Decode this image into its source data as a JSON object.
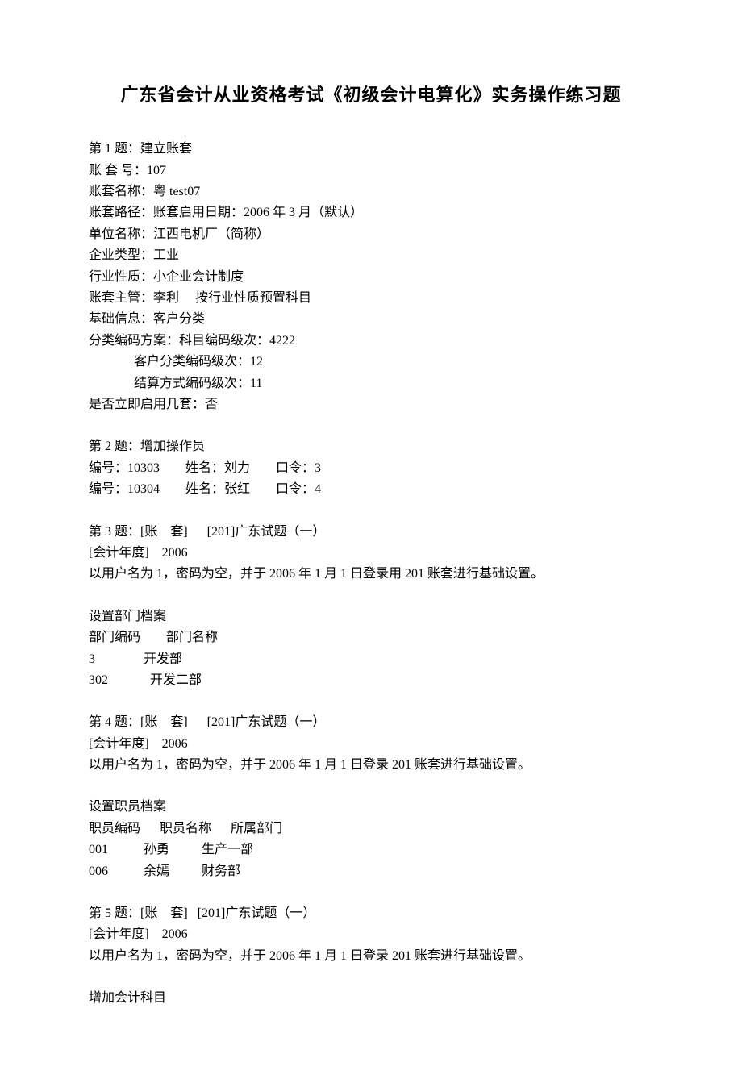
{
  "title": "广东省会计从业资格考试《初级会计电算化》实务操作练习题",
  "q1": {
    "heading": "第 1 题：建立账套",
    "l1": "账 套 号：107",
    "l2": "账套名称：粤 test07",
    "l3": "账套路径：账套启用日期：2006 年 3 月（默认）",
    "l4": "单位名称：江西电机厂（简称）",
    "l5": "企业类型：工业",
    "l6": "行业性质：小企业会计制度",
    "l7": "账套主管：李利     按行业性质预置科目",
    "l8": "基础信息：客户分类",
    "l9": "分类编码方案：科目编码级次：4222",
    "l10": "              客户分类编码级次：12",
    "l11": "              结算方式编码级次：11",
    "l12": "是否立即启用几套：否"
  },
  "q2": {
    "heading": "第 2 题：增加操作员",
    "l1": "编号：10303        姓名：刘力        口令：3",
    "l2": "编号：10304        姓名：张红        口令：4"
  },
  "q3": {
    "heading": "第 3 题：[账    套]      [201]广东试题（一）",
    "l1": "[会计年度]    2006",
    "l2": "以用户名为 1，密码为空，并于 2006 年 1 月 1 日登录用 201 账套进行基础设置。",
    "sub1": "设置部门档案",
    "sub2": "部门编码        部门名称",
    "sub3": "3               开发部",
    "sub4": "302             开发二部"
  },
  "q4": {
    "heading": "第 4 题：[账    套]      [201]广东试题（一）",
    "l1": "[会计年度]    2006",
    "l2": "以用户名为 1，密码为空，并于 2006 年 1 月 1 日登录 201 账套进行基础设置。",
    "sub1": "设置职员档案",
    "sub2": "职员编码      职员名称      所属部门",
    "sub3": "001           孙勇          生产一部",
    "sub4": "006           余嫣          财务部"
  },
  "q5": {
    "heading": "第 5 题：[账    套]   [201]广东试题（一）",
    "l1": "[会计年度]    2006",
    "l2": "以用户名为 1，密码为空，并于 2006 年 1 月 1 日登录 201 账套进行基础设置。",
    "sub1": "增加会计科目"
  }
}
